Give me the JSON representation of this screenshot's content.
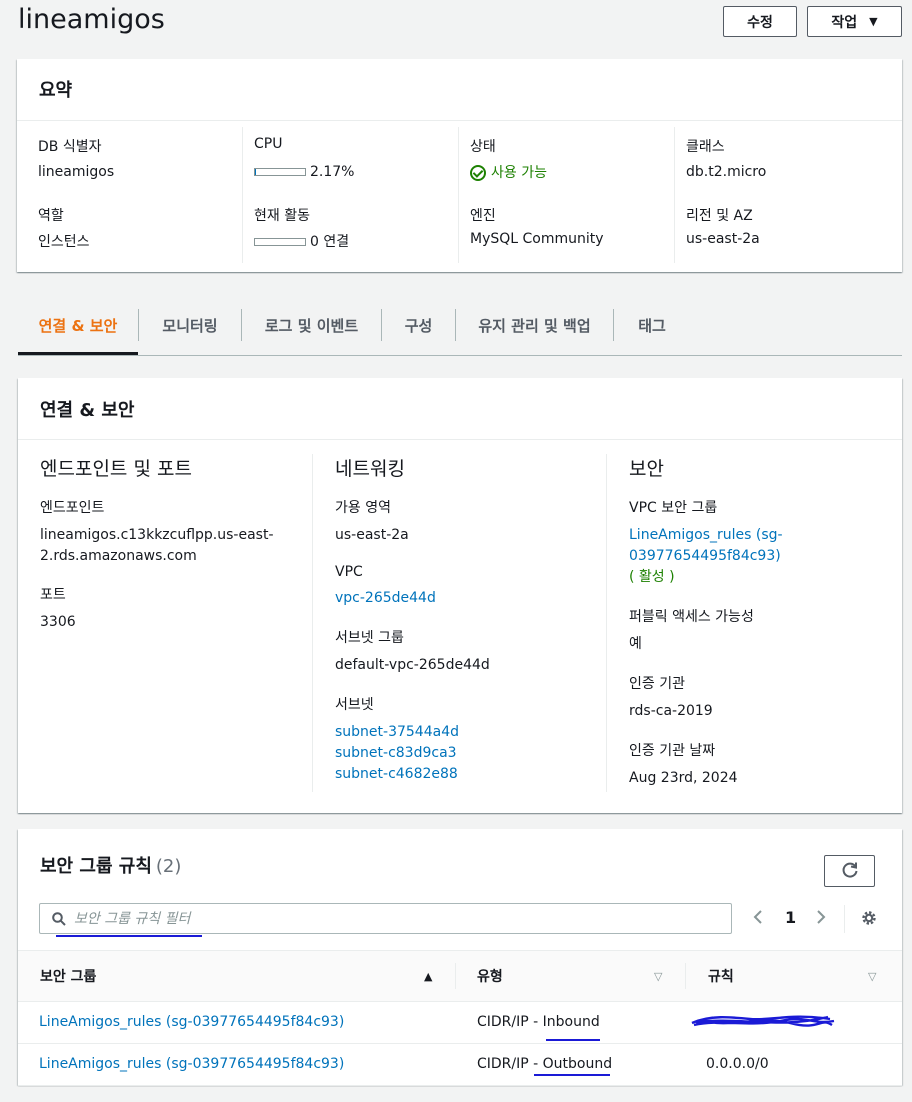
{
  "header": {
    "title": "lineamigos",
    "edit_label": "수정",
    "actions_label": "작업"
  },
  "summary": {
    "title": "요약",
    "db_identifier_label": "DB 식별자",
    "db_identifier_value": "lineamigos",
    "role_label": "역할",
    "role_value": "인스턴스",
    "cpu_label": "CPU",
    "cpu_value": "2.17%",
    "cpu_fraction": 0.0217,
    "activity_label": "현재 활동",
    "activity_value": "0 연결",
    "activity_fraction": 0,
    "status_label": "상태",
    "status_value": "사용 가능",
    "engine_label": "엔진",
    "engine_value": "MySQL Community",
    "class_label": "클래스",
    "class_value": "db.t2.micro",
    "region_label": "리전 및 AZ",
    "region_value": "us-east-2a"
  },
  "tabs": [
    {
      "label": "연결 & 보안",
      "active": true
    },
    {
      "label": "모니터링"
    },
    {
      "label": "로그 및 이벤트"
    },
    {
      "label": "구성"
    },
    {
      "label": "유지 관리 및 백업"
    },
    {
      "label": "태그"
    }
  ],
  "connectivity": {
    "title": "연결 & 보안",
    "endpoint_section": {
      "title": "엔드포인트 및 포트",
      "endpoint_label": "엔드포인트",
      "endpoint_value_1": "lineamigos.c13kkzcuflpp.us-east-",
      "endpoint_value_2": "2.rds.amazonaws.com",
      "port_label": "포트",
      "port_value": "3306"
    },
    "network_section": {
      "title": "네트워킹",
      "az_label": "가용 영역",
      "az_value": "us-east-2a",
      "vpc_label": "VPC",
      "vpc_value": "vpc-265de44d",
      "subnet_group_label": "서브넷 그룹",
      "subnet_group_value": "default-vpc-265de44d",
      "subnets_label": "서브넷",
      "subnets": [
        "subnet-37544a4d",
        "subnet-c83d9ca3",
        "subnet-c4682e88"
      ]
    },
    "security_section": {
      "title": "보안",
      "sg_label": "VPC 보안 그룹",
      "sg_value_1": "LineAmigos_rules (sg-",
      "sg_value_2": "03977654495f84c93)",
      "sg_status": "( 활성 )",
      "public_label": "퍼블릭 액세스 가능성",
      "public_value": "예",
      "ca_label": "인증 기관",
      "ca_value": "rds-ca-2019",
      "ca_date_label": "인증 기관 날짜",
      "ca_date_value": "Aug 23rd, 2024"
    }
  },
  "rules": {
    "title": "보안 그룹 규칙",
    "count": "(2)",
    "filter_placeholder": "보안 그룹 규칙 필터",
    "page": "1",
    "columns": [
      "보안 그룹",
      "유형",
      "규칙"
    ],
    "rows": [
      {
        "group": "LineAmigos_rules (sg-03977654495f84c93)",
        "type_prefix": "CIDR/IP - ",
        "type_dir": "Inbound",
        "rule": ""
      },
      {
        "group": "LineAmigos_rules (sg-03977654495f84c93)",
        "type_prefix": "CIDR/IP - ",
        "type_dir": "Outbound",
        "rule": "0.0.0.0/0"
      }
    ]
  },
  "colors": {
    "accent_orange": "#ec7211",
    "link_blue": "#0073bb",
    "success_green": "#1d8102",
    "annotation_blue": "#1a1ad6"
  }
}
